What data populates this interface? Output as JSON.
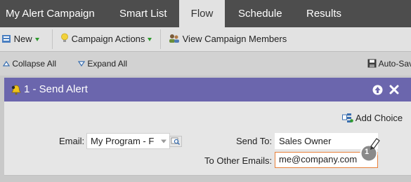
{
  "tabs": [
    {
      "label": "My Alert Campaign"
    },
    {
      "label": "Smart List"
    },
    {
      "label": "Flow"
    },
    {
      "label": "Schedule"
    },
    {
      "label": "Results"
    }
  ],
  "toolbar": {
    "new_label": "New",
    "campaign_actions_label": "Campaign Actions",
    "view_members_label": "View Campaign Members"
  },
  "subbar": {
    "collapse_label": "Collapse All",
    "expand_label": "Expand All",
    "autosave_label": "Auto-Sav"
  },
  "panel": {
    "title": "1 - Send Alert",
    "add_choice_label": "Add Choice"
  },
  "form": {
    "email_label": "Email:",
    "email_value": "My Program - F",
    "send_to_label": "Send To:",
    "send_to_value": "Sales Owner",
    "other_emails_label": "To Other Emails:",
    "other_emails_value": "me@company.com"
  },
  "callout": {
    "number": "1"
  },
  "colors": {
    "tabbar": "#4d4d4d",
    "panel_header": "#6b66ad",
    "highlight_border": "#e8803a"
  }
}
